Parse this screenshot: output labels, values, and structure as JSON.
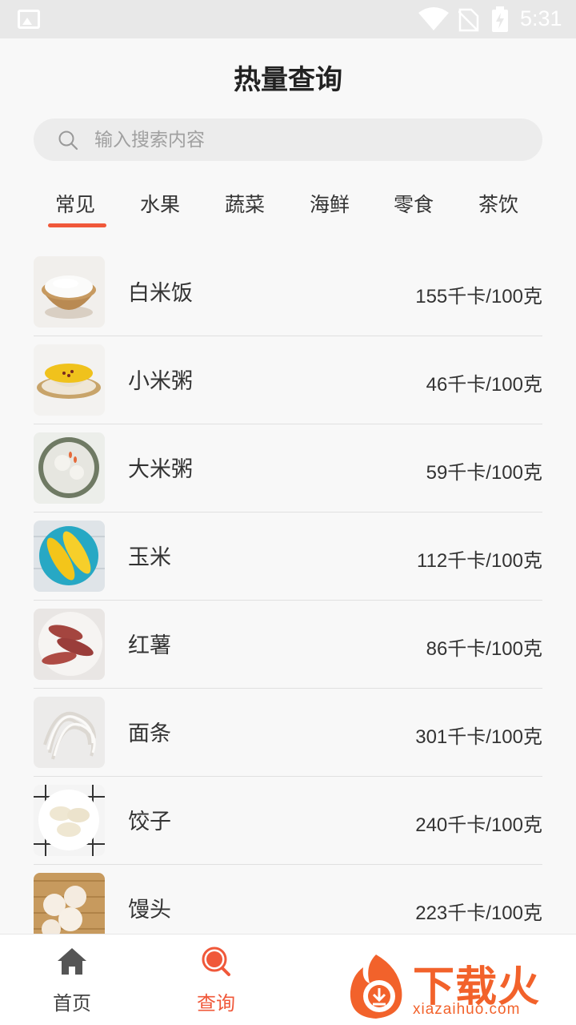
{
  "status_bar": {
    "time": "5:31"
  },
  "header": {
    "title": "热量查询"
  },
  "search": {
    "placeholder": "输入搜索内容"
  },
  "tabs": [
    {
      "label": "常见",
      "active": true
    },
    {
      "label": "水果",
      "active": false
    },
    {
      "label": "蔬菜",
      "active": false
    },
    {
      "label": "海鲜",
      "active": false
    },
    {
      "label": "零食",
      "active": false
    },
    {
      "label": "茶饮",
      "active": false
    }
  ],
  "foods": [
    {
      "name": "白米饭",
      "calories": "155千卡/100克",
      "image": "rice-bowl"
    },
    {
      "name": "小米粥",
      "calories": "46千卡/100克",
      "image": "millet-porridge"
    },
    {
      "name": "大米粥",
      "calories": "59千卡/100克",
      "image": "rice-porridge"
    },
    {
      "name": "玉米",
      "calories": "112千卡/100克",
      "image": "corn"
    },
    {
      "name": "红薯",
      "calories": "86千卡/100克",
      "image": "sweet-potato"
    },
    {
      "name": "面条",
      "calories": "301千卡/100克",
      "image": "noodles"
    },
    {
      "name": "饺子",
      "calories": "240千卡/100克",
      "image": "dumplings"
    },
    {
      "name": "馒头",
      "calories": "223千卡/100克",
      "image": "steamed-buns"
    }
  ],
  "bottom_nav": [
    {
      "label": "首页",
      "icon": "home-icon",
      "active": false
    },
    {
      "label": "查询",
      "icon": "search-icon",
      "active": true
    }
  ],
  "watermark": {
    "title": "下载火",
    "subtitle": "xiazaihuo.com"
  },
  "colors": {
    "accent": "#f0583a",
    "background": "#f8f8f8",
    "status_bar": "#e8e8e8"
  }
}
